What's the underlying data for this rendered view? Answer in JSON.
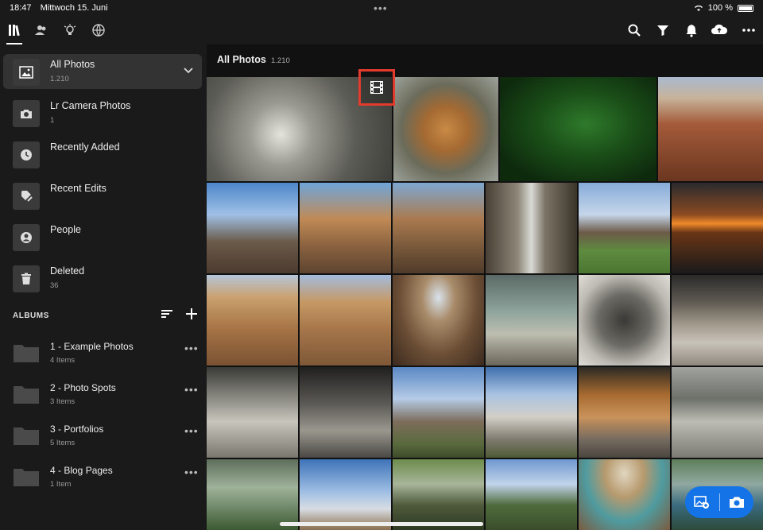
{
  "status": {
    "time": "18:47",
    "date": "Mittwoch 15. Juni",
    "battery": "100 %"
  },
  "top_tabs": [
    {
      "icon": "library-icon",
      "active": true
    },
    {
      "icon": "people-icon",
      "active": false
    },
    {
      "icon": "learn-icon",
      "active": false
    },
    {
      "icon": "discover-icon",
      "active": false
    }
  ],
  "toolbar": [
    "search-icon",
    "filter-icon",
    "notifications-icon",
    "cloud-icon",
    "more-icon"
  ],
  "sidebar": {
    "items": [
      {
        "label": "All Photos",
        "count": "1.210",
        "icon": "photo-icon"
      },
      {
        "label": "Lr Camera Photos",
        "count": "1",
        "icon": "camera-icon"
      },
      {
        "label": "Recently Added",
        "count": "",
        "icon": "clock-icon"
      },
      {
        "label": "Recent Edits",
        "count": "",
        "icon": "edit-icon"
      },
      {
        "label": "People",
        "count": "",
        "icon": "person-icon"
      },
      {
        "label": "Deleted",
        "count": "36",
        "icon": "trash-icon"
      }
    ],
    "albums_header": "ALBUMS",
    "albums": [
      {
        "label": "1 - Example Photos",
        "count": "4 Items"
      },
      {
        "label": "2 - Photo Spots",
        "count": "3 Items"
      },
      {
        "label": "3 - Portfolios",
        "count": "5 Items"
      },
      {
        "label": "4 - Blog Pages",
        "count": "1 Item"
      }
    ]
  },
  "main": {
    "title": "All Photos",
    "count": "1.210"
  },
  "colors": {
    "accent": "#1473e6",
    "highlight": "#e23b2e"
  }
}
